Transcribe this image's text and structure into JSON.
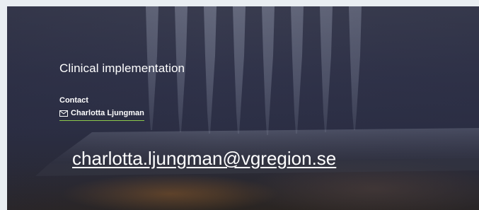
{
  "section": {
    "heading": "Clinical implementation",
    "contact_label": "Contact",
    "contact_name": "Charlotta Ljungman",
    "contact_icon": "envelope-icon",
    "email": "charlotta.ljungman@vgregion.se"
  },
  "colors": {
    "accent_underline": "#8cc84b",
    "text": "#ffffff",
    "background": "#30334a"
  }
}
